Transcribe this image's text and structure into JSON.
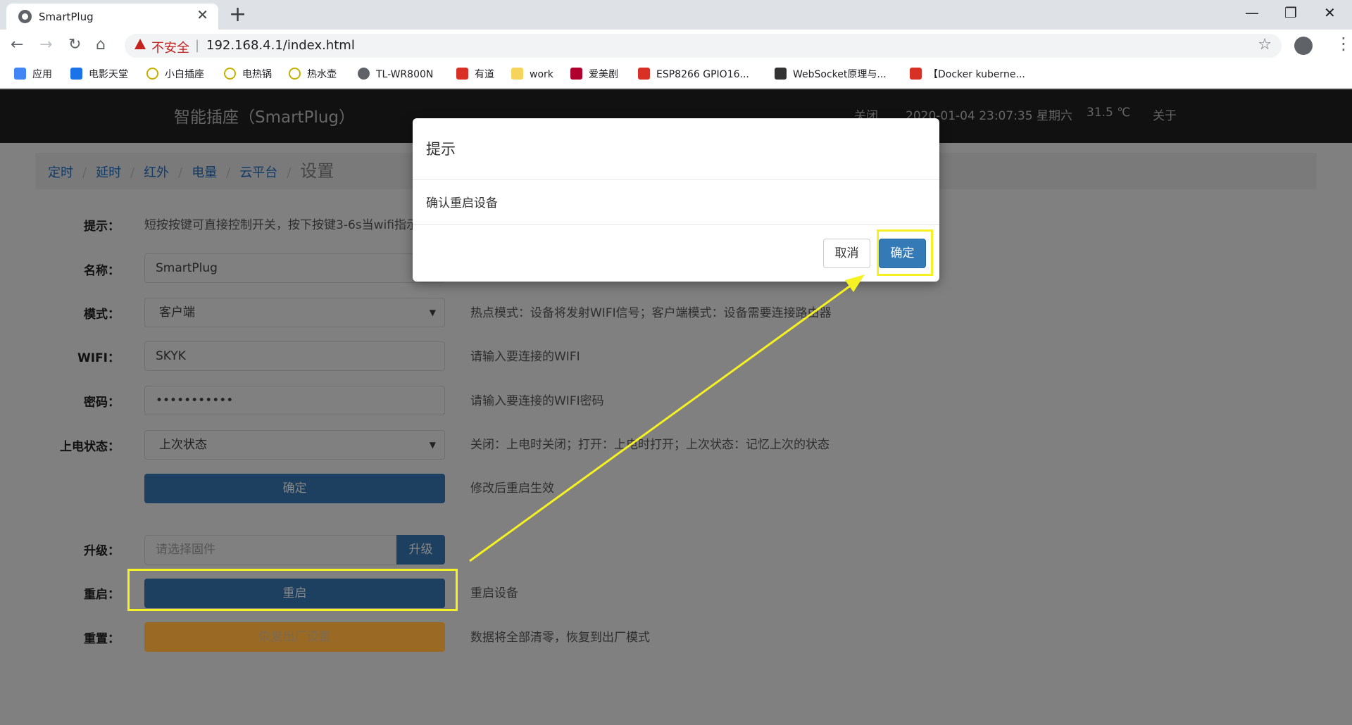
{
  "browser": {
    "tab_title": "SmartPlug",
    "tab_close": "✕",
    "new_tab": "+",
    "win_min": "—",
    "win_max": "❐",
    "win_close": "✕",
    "back": "←",
    "forward": "→",
    "reload": "↻",
    "home": "⌂",
    "security_label": "不安全",
    "separator": "|",
    "url": "192.168.4.1/index.html",
    "star": "☆",
    "menu": "⋮",
    "bookmarks": [
      {
        "label": "应用",
        "icon": "apps-grid-icon",
        "color": "#4285f4"
      },
      {
        "label": "电影天堂",
        "icon": "movie-icon",
        "color": "#1a73e8"
      },
      {
        "label": "小白插座",
        "icon": "plug-icon",
        "color": "#c5b000"
      },
      {
        "label": "电热锅",
        "icon": "plug-icon",
        "color": "#c5b000"
      },
      {
        "label": "热水壶",
        "icon": "plug-icon",
        "color": "#c5b000"
      },
      {
        "label": "TL-WR800N",
        "icon": "globe-icon",
        "color": "#5f6368"
      },
      {
        "label": "有道",
        "icon": "youdao-icon",
        "color": "#d93025"
      },
      {
        "label": "work",
        "icon": "folder-icon",
        "color": "#f6d35b"
      },
      {
        "label": "爱美剧",
        "icon": "tv-icon",
        "color": "#b00030"
      },
      {
        "label": "ESP8266 GPIO16...",
        "icon": "csdn-icon",
        "color": "#d93025"
      },
      {
        "label": "WebSocket原理与...",
        "icon": "websocket-icon",
        "color": "#333333"
      },
      {
        "label": "【Docker kuberne...",
        "icon": "csdn-icon",
        "color": "#d93025"
      }
    ]
  },
  "navbar": {
    "brand": "智能插座（SmartPlug）",
    "state": "关闭",
    "datetime": "2020-01-04 23:07:35 星期六",
    "temperature": "31.5 ℃",
    "about": "关于"
  },
  "breadcrumb": {
    "items": [
      "定时",
      "延时",
      "红外",
      "电量",
      "云平台"
    ],
    "divider": "/",
    "current": "设置"
  },
  "form": {
    "tip_label": "提示：",
    "tip_text": "短按按键可直接控制开关，按下按键3-6s当wifi指示",
    "name_label": "名称：",
    "name_value": "SmartPlug",
    "mode_label": "模式：",
    "mode_value": "客户端",
    "mode_help": "热点模式：设备将发射WIFI信号；客户端模式：设备需要连接路由器",
    "wifi_label": "WIFI：",
    "wifi_value": "SKYK",
    "wifi_help": "请输入要连接的WIFI",
    "password_label": "密码：",
    "password_value": "•••••••••••",
    "password_help": "请输入要连接的WIFI密码",
    "power_label": "上电状态：",
    "power_value": "上次状态",
    "power_help": "关闭：上电时关闭；打开：上电时打开；上次状态：记忆上次的状态",
    "submit_label": "确定",
    "submit_help": "修改后重启生效",
    "upgrade_label": "升级：",
    "upgrade_placeholder": "请选择固件",
    "upgrade_button": "升级",
    "restart_label": "重启：",
    "restart_button": "重启",
    "restart_help": "重启设备",
    "reset_label": "重置：",
    "reset_button": "恢复出厂设置",
    "reset_help": "数据将全部清零，恢复到出厂模式",
    "select_arrow": "▼"
  },
  "modal": {
    "title": "提示",
    "message": "确认重启设备",
    "cancel": "取消",
    "confirm": "确定"
  },
  "annotation_color": "#f5f122"
}
